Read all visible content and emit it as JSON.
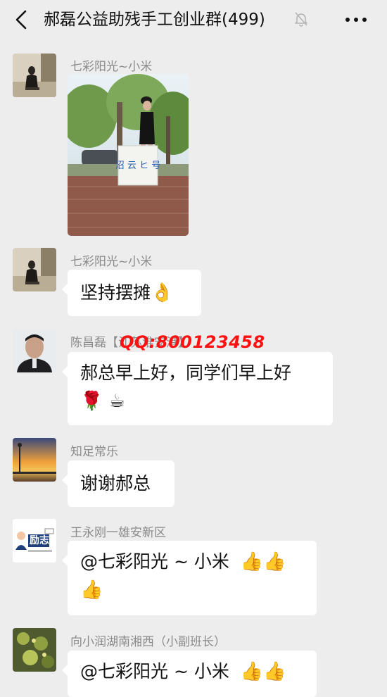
{
  "header": {
    "title": "郝磊公益助残手工创业群(499)",
    "back_icon": "chevron-left-icon",
    "mute_icon": "bell-muted-icon",
    "more_icon": "more-dots-icon"
  },
  "messages": [
    {
      "sender": "七彩阳光~小米",
      "type": "image"
    },
    {
      "sender": "七彩阳光~小米",
      "text": "坚持摆摊",
      "emoji": "👌"
    },
    {
      "sender": "陈昌磊【江苏淮安港】",
      "text_line1": "郝总早上好，同学们早上好",
      "emoji_line2": "🌹 ☕"
    },
    {
      "sender": "知足常乐",
      "text": "谢谢郝总"
    },
    {
      "sender": "王永刚一雄安新区",
      "text": "@七彩阳光 ~ 小米",
      "emoji_line1": "👍👍",
      "emoji_line2": "👍",
      "avatar_text": "励志"
    },
    {
      "sender": "向小润湖南湘西（小副班长）",
      "text": "@七彩阳光 ~ 小米",
      "emoji_line1": "👍👍"
    }
  ],
  "watermark": "QQ:800123458",
  "colors": {
    "background": "#ededed",
    "bubble": "#ffffff",
    "sender_text": "#8a8a8a",
    "watermark": "#ff1111"
  }
}
